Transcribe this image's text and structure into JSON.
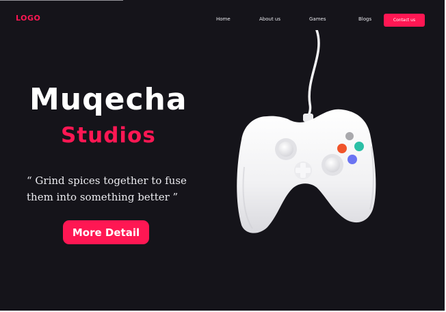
{
  "header": {
    "logo": "LOGO",
    "nav": [
      "Home",
      "About us",
      "Games",
      "Blogs"
    ],
    "contact_label": "Contact us"
  },
  "hero": {
    "title": "Muqecha",
    "subtitle": "Studios",
    "quote_line1": "“ Grind spices together to fuse",
    "quote_line2": "them into something better ”",
    "button_label": "More Detail"
  },
  "image": {
    "icon": "game-controller-icon"
  },
  "colors": {
    "background": "#15141a",
    "accent": "#ff1753",
    "text": "#ffffff",
    "button_orange": "#f0542b",
    "button_teal": "#2bbfa6",
    "button_blue": "#6b74f2",
    "button_grey": "#a9a9ad"
  }
}
